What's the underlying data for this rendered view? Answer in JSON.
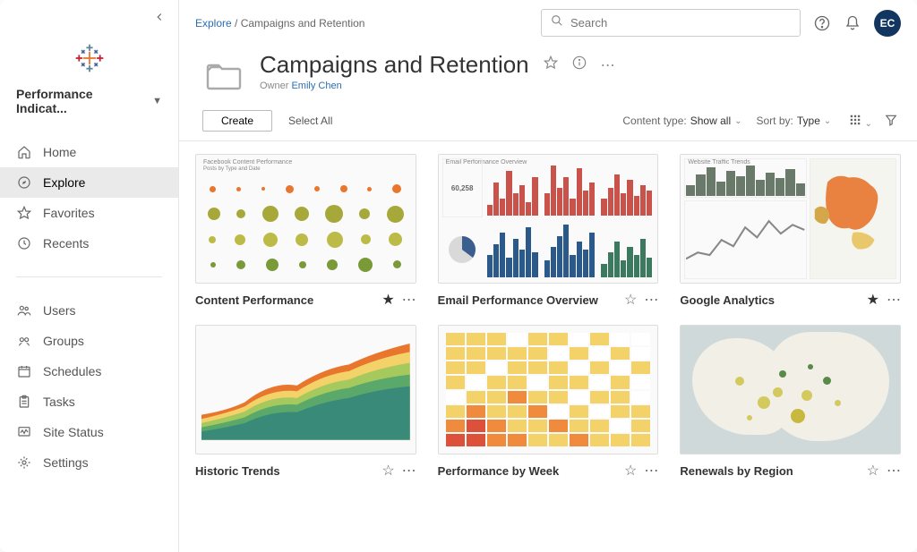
{
  "site_selector": "Performance Indicat...",
  "nav": {
    "primary": [
      {
        "label": "Home",
        "icon": "home"
      },
      {
        "label": "Explore",
        "icon": "explore",
        "active": true
      },
      {
        "label": "Favorites",
        "icon": "star"
      },
      {
        "label": "Recents",
        "icon": "clock"
      }
    ],
    "admin": [
      {
        "label": "Users",
        "icon": "users"
      },
      {
        "label": "Groups",
        "icon": "groups"
      },
      {
        "label": "Schedules",
        "icon": "schedules"
      },
      {
        "label": "Tasks",
        "icon": "tasks"
      },
      {
        "label": "Site Status",
        "icon": "status"
      },
      {
        "label": "Settings",
        "icon": "gear"
      }
    ]
  },
  "breadcrumb": {
    "root": "Explore",
    "sep": "/",
    "current": "Campaigns and Retention"
  },
  "search": {
    "placeholder": "Search"
  },
  "avatar_initials": "EC",
  "page": {
    "title": "Campaigns and Retention",
    "owner_label": "Owner",
    "owner_name": "Emily Chen"
  },
  "toolbar": {
    "create": "Create",
    "select_all": "Select All",
    "content_type_label": "Content type:",
    "content_type_value": "Show all",
    "sort_label": "Sort by:",
    "sort_value": "Type"
  },
  "cards": [
    {
      "title": "Content Performance",
      "starred": true,
      "thumb_title": "Facebook Content Performance",
      "thumb_sub": "Posts by Type and Date"
    },
    {
      "title": "Email Performance Overview",
      "starred": false,
      "thumb_title": "Email Performance Overview",
      "thumb_stat": "60,258"
    },
    {
      "title": "Google Analytics",
      "starred": true,
      "thumb_title": "Website Traffic Trends"
    },
    {
      "title": "Historic Trends",
      "starred": false
    },
    {
      "title": "Performance by Week",
      "starred": false
    },
    {
      "title": "Renewals by Region",
      "starred": false
    }
  ]
}
